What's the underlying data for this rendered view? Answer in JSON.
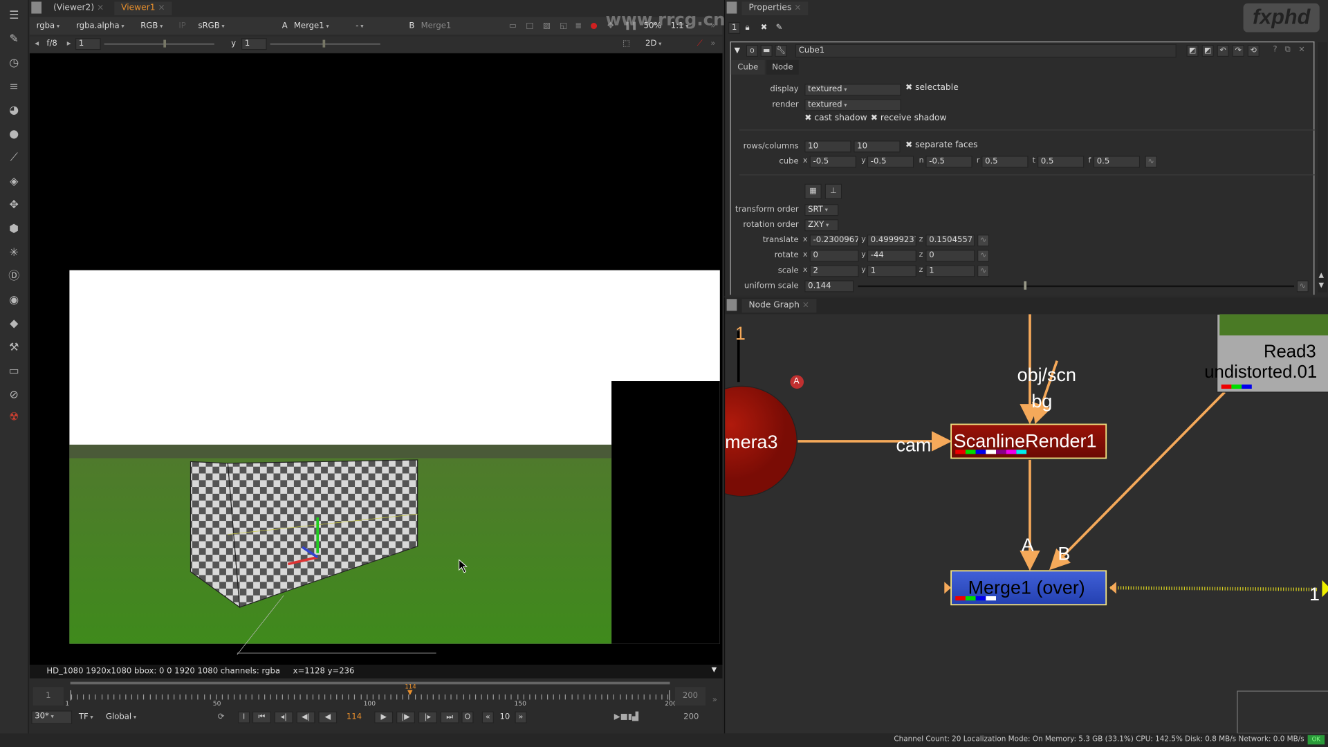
{
  "viewer": {
    "tabs": [
      {
        "label": "(Viewer2)"
      },
      {
        "label": "Viewer1"
      }
    ],
    "toolbar": {
      "channels": "rgba",
      "alpha": "rgba.alpha",
      "display": "RGB",
      "ip": "IP",
      "lut": "sRGB",
      "a_label": "A",
      "a_input": "Merge1",
      "wipe": "-",
      "b_label": "B",
      "b_input": "Merge1",
      "zoom": "50%",
      "ratio": "1:1"
    },
    "row2": {
      "fstop": "f/8",
      "gain": "1",
      "gamma_label": "y",
      "gamma": "1",
      "view_mode": "2D"
    },
    "info": "HD_1080 1920x1080  bbox: 0 0 1920 1080 channels: rgba",
    "coords": "x=1128 y=236"
  },
  "timeline": {
    "start": "1",
    "end": "200",
    "ticks": [
      "1",
      "50",
      "100",
      "150",
      "200"
    ],
    "current": "114",
    "current_frame": 114,
    "first": 1,
    "last": 200,
    "fps": "30*",
    "tf": "TF",
    "scope": "Global",
    "step": "10",
    "end_right": "200"
  },
  "properties": {
    "tab": "Properties",
    "panel_count": "1",
    "node_name": "Cube1",
    "tabs": [
      {
        "label": "Cube"
      },
      {
        "label": "Node"
      }
    ],
    "display": {
      "label": "display",
      "value": "textured"
    },
    "selectable": "selectable",
    "render": {
      "label": "render",
      "value": "textured"
    },
    "cast_shadow": "cast shadow",
    "receive_shadow": "receive shadow",
    "rows_columns": {
      "label": "rows/columns",
      "rows": "10",
      "columns": "10"
    },
    "separate_faces": "separate faces",
    "cube": {
      "label": "cube",
      "x": "-0.5",
      "y": "-0.5",
      "n": "-0.5",
      "r": "0.5",
      "t": "0.5",
      "f": "0.5"
    },
    "transform_order": {
      "label": "transform order",
      "value": "SRT"
    },
    "rotation_order": {
      "label": "rotation order",
      "value": "ZXY"
    },
    "translate": {
      "label": "translate",
      "x": "-0.2300967",
      "y": "0.49999237",
      "z": "0.1504557"
    },
    "rotate": {
      "label": "rotate",
      "x": "0",
      "y": "-44",
      "z": "0"
    },
    "scale": {
      "label": "scale",
      "x": "2",
      "y": "1",
      "z": "1"
    },
    "uniform_scale": {
      "label": "uniform scale",
      "value": "0.144"
    }
  },
  "node_graph": {
    "tab": "Node Graph",
    "nodes": {
      "camera": "mera3",
      "scanline": "ScanlineRender1",
      "merge": "Merge1 (over)",
      "read": "Read3",
      "read_file": "undistorted.01"
    },
    "edge_labels": {
      "cam": "cam",
      "obj": "obj/scn",
      "bg": "bg",
      "a": "A",
      "b": "B",
      "one": "1",
      "one_right": "1",
      "badge": "A"
    },
    "colors": {
      "edge": "#f5a95a",
      "scanline": "#8a0f0a",
      "merge": "#3150c8",
      "camera": "#9a1208"
    }
  },
  "status": {
    "text": "Channel Count: 20 Localization Mode: On Memory: 5.3 GB (33.1%) CPU: 142.5% Disk: 0.8 MB/s Network: 0.0 MB/s",
    "ok": "OK"
  },
  "watermarks": {
    "site": "www.rrcg.cn",
    "brand": "fxphd"
  }
}
